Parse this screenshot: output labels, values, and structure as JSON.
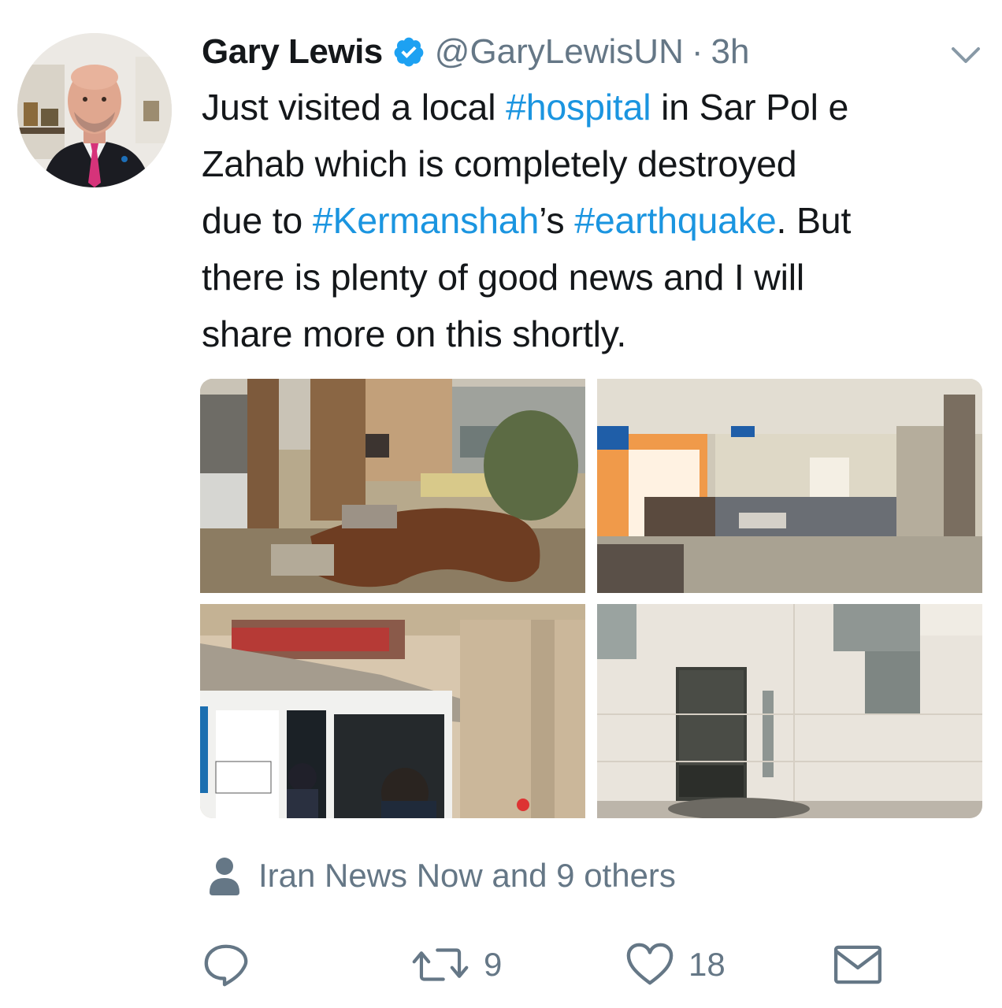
{
  "tweet": {
    "author": {
      "display_name": "Gary Lewis",
      "handle": "@GaryLewisUN",
      "separator": "·",
      "time": "3h",
      "verified": true
    },
    "text_lines": [
      [
        {
          "t": "Just visited a local ",
          "tag": false
        },
        {
          "t": "#hospital",
          "tag": true
        },
        {
          "t": " in Sar Pol e",
          "tag": false
        }
      ],
      [
        {
          "t": "Zahab which is completely destroyed",
          "tag": false
        }
      ],
      [
        {
          "t": "due to ",
          "tag": false
        },
        {
          "t": "#Kermanshah",
          "tag": true
        },
        {
          "t": "’s ",
          "tag": false
        },
        {
          "t": "#earthquake",
          "tag": true
        },
        {
          "t": ". But",
          "tag": false
        }
      ],
      [
        {
          "t": "there is plenty of good news and I will",
          "tag": false
        }
      ],
      [
        {
          "t": "share more on this shortly.",
          "tag": false
        }
      ]
    ],
    "media": [
      {
        "description": "rubble outside damaged hospital building"
      },
      {
        "description": "empty hospital lobby with debris"
      },
      {
        "description": "cracked facade above entrance doors"
      },
      {
        "description": "marble wall with fallen tiles"
      }
    ],
    "tagged": {
      "text": "Iran News Now and 9 others",
      "icon": "person-icon"
    },
    "actions": {
      "reply": {
        "icon": "reply-icon",
        "count": ""
      },
      "retweet": {
        "icon": "retweet-icon",
        "count": "9"
      },
      "like": {
        "icon": "heart-icon",
        "count": "18"
      },
      "message": {
        "icon": "envelope-icon",
        "count": ""
      }
    }
  },
  "colors": {
    "text": "#14171a",
    "secondary": "#657786",
    "link": "#1b95e0",
    "verified": "#1da1f2"
  }
}
